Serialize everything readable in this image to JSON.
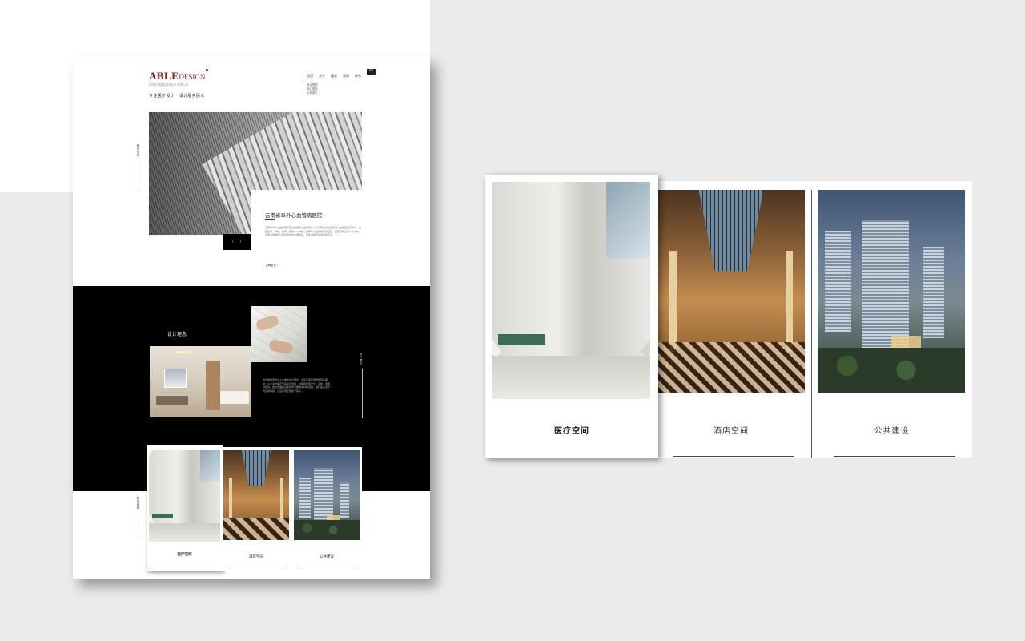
{
  "logo": {
    "brand_bold": "ABLE",
    "brand_light": "DESIGN",
    "company": "昆明艾博建筑装饰设计有限公司"
  },
  "nav": {
    "items": [
      "首页",
      "关于",
      "服务",
      "案例",
      "联系"
    ],
    "lang": "EN",
    "sub_items": [
      "设计理念",
      "核心团队",
      "公司简介"
    ]
  },
  "tagline": [
    "专注医疗设计",
    "设计服务民众"
  ],
  "side_labels": {
    "hero": "医疗空间",
    "concept": "设计理念",
    "cases": "精选案例"
  },
  "hero_card": {
    "title": "云南省阜外心血管病医院",
    "body": "云南省阜外心血管病医院是由国家心血管病中心与云南省共建的区域心血管病医疗中心，是集医疗、教学、科研、预防为一体的三级甲等心血管病专科医院。医院建筑设计以人为本，注重患者体验与医护流线的合理组织，营造温馨舒适的就医环境。",
    "more": "了解更多",
    "arrow_prev": "‹",
    "arrow_next": "›"
  },
  "concept": {
    "title": "设计理念",
    "body": "我们始终坚持以人为本的设计理念，关注空间使用者的真实需求，以专业的医疗空间设计经验，为医院营造安全、高效、温馨的环境。通过合理的功能布局与细致的材料选择，提升医患双方的空间体验，让设计真正服务于民众。"
  },
  "categories": [
    {
      "label": "医疗空间",
      "active": true
    },
    {
      "label": "酒店空间",
      "active": false
    },
    {
      "label": "公共建设",
      "active": false
    }
  ],
  "colors": {
    "brand": "#7a1d1d",
    "dark_section": "#000000",
    "background": "#ebebeb"
  }
}
